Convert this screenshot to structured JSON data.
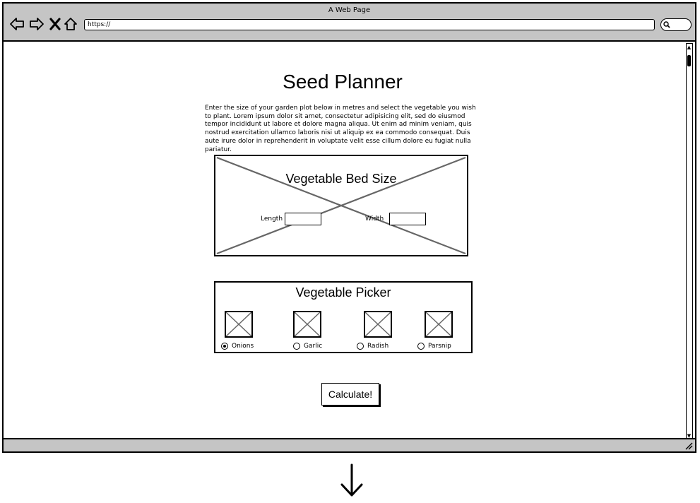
{
  "window": {
    "title": "A Web Page",
    "url": "https://"
  },
  "nav_icons": [
    "back-arrow-icon",
    "forward-arrow-icon",
    "close-x-icon",
    "home-icon"
  ],
  "page": {
    "title": "Seed Planner",
    "intro": "Enter the size of your garden plot below in metres and select the vegetable you wish to plant. Lorem ipsum dolor sit amet, consectetur adipisicing elit, sed do eiusmod tempor incididunt ut labore et dolore magna aliqua. Ut enim ad minim veniam, quis nostrud exercitation ullamco laboris nisi ut aliquip ex ea commodo consequat. Duis aute irure dolor in reprehenderit in voluptate velit esse cillum dolore eu fugiat nulla pariatur.",
    "bed_size": {
      "title": "Vegetable Bed Size",
      "length_label": "Length",
      "length_value": "",
      "width_label": "Width",
      "width_value": ""
    },
    "picker": {
      "title": "Vegetable Picker",
      "options": [
        {
          "label": "Onions",
          "selected": true
        },
        {
          "label": "Garlic",
          "selected": false
        },
        {
          "label": "Radish",
          "selected": false
        },
        {
          "label": "Parsnip",
          "selected": false
        }
      ]
    },
    "calculate_label": "Calculate!"
  }
}
